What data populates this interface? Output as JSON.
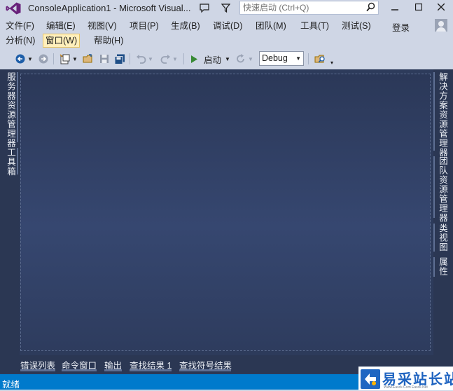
{
  "window": {
    "title": "ConsoleApplication1 - Microsoft Visual...",
    "quick_launch_placeholder": "快速启动 (Ctrl+Q)",
    "icons": [
      "visual-studio-logo",
      "notifications-icon",
      "feedback-filter-icon",
      "search-icon",
      "minimize-icon",
      "maximize-icon",
      "close-icon"
    ]
  },
  "menu": {
    "row1": [
      "文件(F)",
      "编辑(E)",
      "视图(V)",
      "项目(P)",
      "生成(B)",
      "调试(D)",
      "团队(M)",
      "工具(T)",
      "测试(S)"
    ],
    "row2": [
      "分析(N)",
      "窗口(W)",
      "帮助(H)"
    ],
    "active": "窗口(W)",
    "login": "登录"
  },
  "toolbar": {
    "start_label": "启动",
    "configuration": "Debug",
    "icons": [
      "back-icon",
      "forward-icon",
      "new-project-icon",
      "open-file-icon",
      "save-icon",
      "save-all-icon",
      "undo-icon",
      "redo-icon",
      "start-icon",
      "refresh-icon",
      "find-in-files-icon"
    ]
  },
  "left_panel_tabs": [
    "服务器资源管理器",
    "工具箱"
  ],
  "right_panel_tabs": [
    "解决方案资源管理器",
    "团队资源管理器",
    "类视图",
    "属性"
  ],
  "bottom_tabs": [
    "错误列表",
    "命令窗口",
    "输出",
    "查找结果 1",
    "查找符号结果"
  ],
  "status": {
    "text": "就绪"
  },
  "watermark": {
    "text": "易采站长站",
    "subtext": "Www.Easck.Com  Easck.Net"
  },
  "colors": {
    "accent": "#007acc",
    "chrome": "#cfd6e5",
    "workspace": "#2d3b5b",
    "menu_highlight": "#ffefbb"
  }
}
